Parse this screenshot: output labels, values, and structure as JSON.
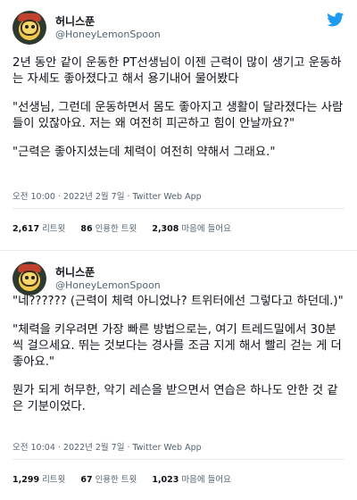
{
  "tweet1": {
    "name": "허니스푼",
    "handle": "@HoneyLemonSpoon",
    "paragraphs": [
      "2년 동안 같이 운동한 PT선생님이 이젠 근력이 많이 생기고 운동하는 자세도 좋아졌다고 해서 용기내어 물어봤다",
      "\"선생님, 그런데 운동하면서 몸도 좋아지고 생활이 달라졌다는 사람들이 있잖아요. 저는 왜 여전히 피곤하고 힘이 안날까요?\"",
      "\"근력은 좋아지셨는데 체력이 여전히 약해서 그래요.\""
    ],
    "meta": "오전 10:00 · 2022년 2월 7일 · Twitter Web App",
    "stats": {
      "retweets_num": "2,617",
      "retweets_label": "리트윗",
      "quotes_num": "86",
      "quotes_label": "인용한 트윗",
      "likes_num": "2,308",
      "likes_label": "마음에 들어요"
    }
  },
  "tweet2": {
    "name": "허니스푼",
    "handle": "@HoneyLemonSpoon",
    "paragraphs": [
      "\"네?????? (근력이 체력 아니었나? 트위터에선 그렇다고 하던데.)\"",
      "\"체력을 키우려면 가장 빠른 방법으로는, 여기 트레드밀에서 30분씩 걸으세요. 뛰는 것보다는 경사를 조금 지게 해서 빨리 걷는 게 더 좋아요.\"",
      "뭔가 되게 허무한, 악기 레슨을 받으면서 연습은 하나도 안한 것 같은 기분이었다."
    ],
    "meta": "오전 10:04 · 2022년 2월 7일 · Twitter Web App",
    "stats": {
      "retweets_num": "1,299",
      "retweets_label": "리트윗",
      "quotes_num": "67",
      "quotes_label": "인용한 트윗",
      "likes_num": "1,023",
      "likes_label": "마음에 들어요"
    }
  },
  "colors": {
    "twitter_blue": "#1d9bf0",
    "secondary_text": "#536471",
    "text": "#0f1419"
  },
  "icons": {
    "logo": "twitter-bird-icon"
  }
}
